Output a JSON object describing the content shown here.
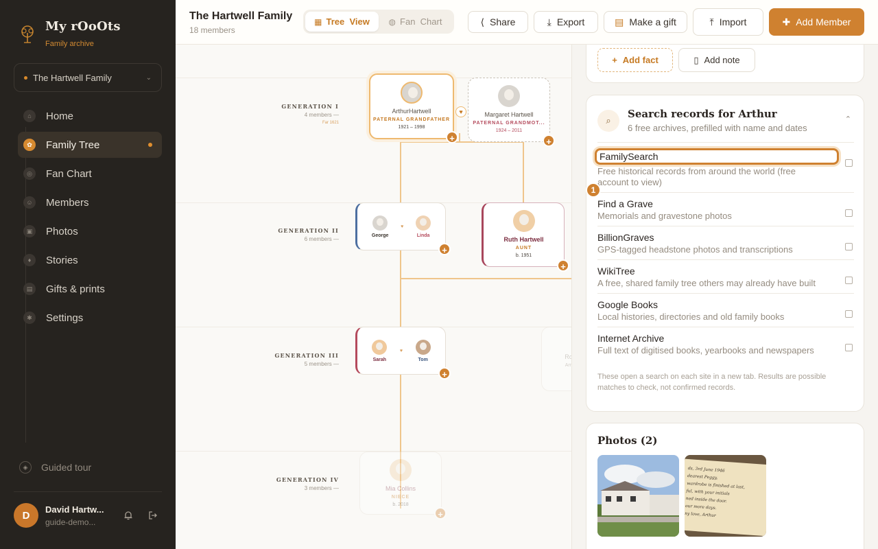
{
  "sidebar": {
    "brand_name": "My rOoOts",
    "brand_sub": "Family archive",
    "family_select": "The Hartwell Family",
    "items": [
      {
        "label": "Home",
        "icon": "home-icon"
      },
      {
        "label": "Family Tree",
        "icon": "tree-icon",
        "active": true
      },
      {
        "label": "Fan Chart",
        "icon": "fan-chart-icon"
      },
      {
        "label": "Members",
        "icon": "members-icon"
      },
      {
        "label": "Photos",
        "icon": "photos-icon"
      },
      {
        "label": "Stories",
        "icon": "stories-icon"
      },
      {
        "label": "Gifts & prints",
        "icon": "gift-icon"
      },
      {
        "label": "Settings",
        "icon": "settings-icon"
      }
    ],
    "guided_tour": "Guided tour",
    "user": {
      "initial": "D",
      "name": "David Hartw...",
      "email": "guide-demo..."
    }
  },
  "header": {
    "title": "The Hartwell Family",
    "subtitle": "18 members",
    "view_tree": "Tree  View",
    "view_fan": "Fan  Chart",
    "share": "Share",
    "export": "Export",
    "gift": "Make a gift",
    "import": "Import",
    "add_member": "Add Member"
  },
  "tree": {
    "generations": [
      {
        "title": "GENERATION I",
        "count": "4 members",
        "extra": "Far 1621"
      },
      {
        "title": "GENERATION II",
        "count": "6 members"
      },
      {
        "title": "GENERATION III",
        "count": "5 members"
      },
      {
        "title": "GENERATION IV",
        "count": "3 members"
      }
    ],
    "arthur": {
      "name": "ArthurHartwell",
      "role": "PATERNAL GRANDFATHER",
      "dates": "1921 – 1998"
    },
    "margaret": {
      "name": "Margaret Hartwell",
      "role": "PATERNAL GRANDMOT...",
      "dates": "1924 – 2011"
    },
    "george": "George",
    "linda": "Linda",
    "ruth": {
      "name": "Ruth Hartwell",
      "role": "AUNT",
      "dates": "b. 1951"
    },
    "sarah": "Sarah",
    "tom": "Tom",
    "mia": {
      "name": "Mia Collins",
      "role": "NIECE",
      "dates": "b. 2018"
    },
    "ghost_name": "Ro",
    "ghost_sub": "Am"
  },
  "panel": {
    "add_fact": "Add fact",
    "add_note": "Add note",
    "search_title": "Search records for Arthur",
    "search_sub": "6 free archives, prefilled with name and dates",
    "badge": "1",
    "records": [
      {
        "name": "FamilySearch",
        "desc": "Free historical records from around the world (free account to view)"
      },
      {
        "name": "Find a Grave",
        "desc": "Memorials and gravestone photos"
      },
      {
        "name": "BillionGraves",
        "desc": "GPS-tagged headstone photos and transcriptions"
      },
      {
        "name": "WikiTree",
        "desc": "A free, shared family tree others may already have built"
      },
      {
        "name": "Google Books",
        "desc": "Local histories, directories and old family books"
      },
      {
        "name": "Internet Archive",
        "desc": "Full text of digitised books, yearbooks and newspapers"
      }
    ],
    "footnote": "These open a search on each site in a new tab. Results are possible matches to check, not confirmed records.",
    "photos_title": "Photos (2)",
    "letter_lines": [
      "ds, 3rd June 1946",
      "dearest Peggy,",
      "wardrobe is finished at last,",
      "ful, with your initials",
      "ned inside the door.",
      "our more days.",
      "ny love, Arthur"
    ]
  },
  "colors": {
    "accent": "#cf8130",
    "sidebar_bg": "#26231f"
  }
}
